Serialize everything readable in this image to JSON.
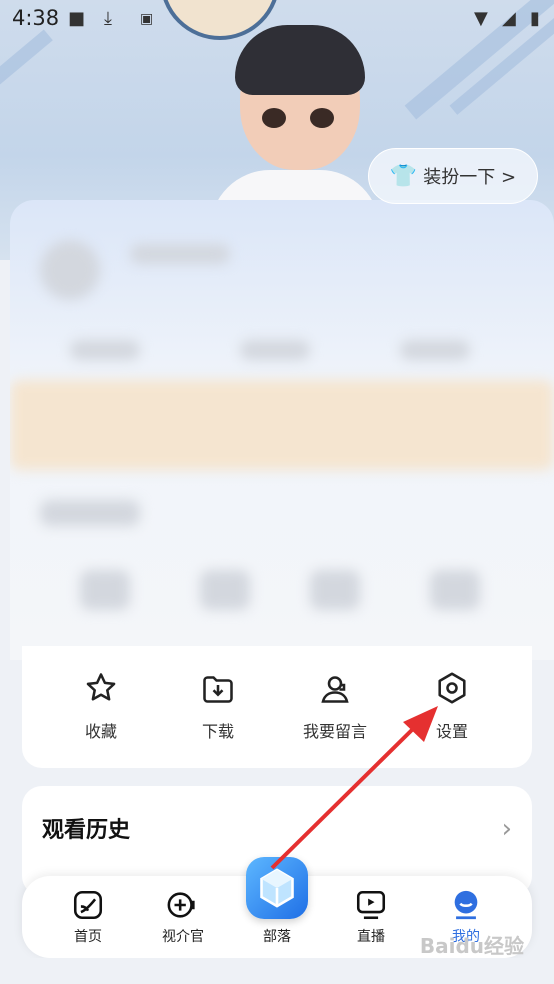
{
  "status_bar": {
    "time": "4:38"
  },
  "profile": {
    "dress_button_label": "装扮一下 >"
  },
  "actions": [
    {
      "label": "收藏",
      "icon": "star-icon"
    },
    {
      "label": "下载",
      "icon": "download-icon"
    },
    {
      "label": "我要留言",
      "icon": "headset-icon"
    },
    {
      "label": "设置",
      "icon": "settings-icon"
    }
  ],
  "history": {
    "title": "观看历史"
  },
  "tabs": [
    {
      "label": "首页",
      "icon": "home-icon"
    },
    {
      "label": "视介官",
      "icon": "video-add-icon"
    },
    {
      "label": "部落",
      "icon": "cube-icon"
    },
    {
      "label": "直播",
      "icon": "live-tv-icon"
    },
    {
      "label": "我的",
      "icon": "profile-icon",
      "active": true
    }
  ],
  "watermark": "Baidu经验",
  "colors": {
    "accent": "#2f6fe0",
    "arrow": "#e53030",
    "dress_icon": "#e94f98"
  }
}
